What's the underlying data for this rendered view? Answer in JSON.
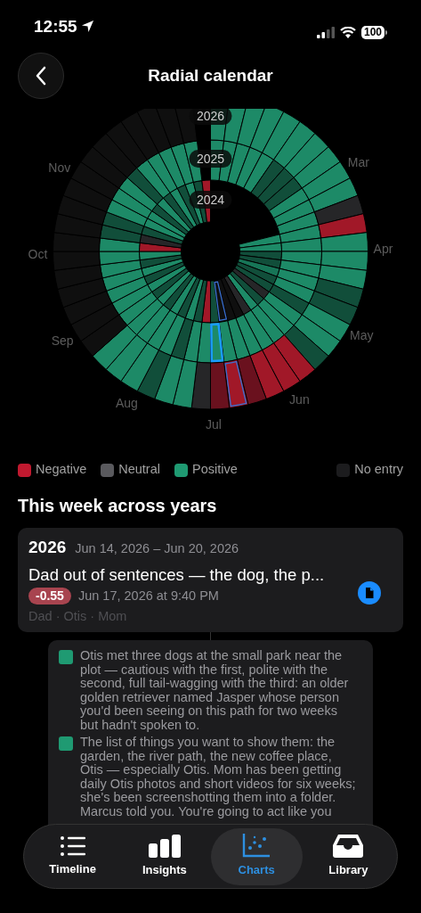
{
  "status_bar": {
    "time": "12:55",
    "battery": "100"
  },
  "header": {
    "title": "Radial calendar"
  },
  "radial_calendar": {
    "years": [
      "2026",
      "2025",
      "2024"
    ],
    "months": [
      "Mar",
      "Apr",
      "May",
      "Jun",
      "Jul",
      "Aug",
      "Sep",
      "Oct",
      "Nov"
    ]
  },
  "legend": [
    {
      "label": "Negative",
      "color": "#c0192f"
    },
    {
      "label": "Neutral",
      "color": "#5a5a5e"
    },
    {
      "label": "Positive",
      "color": "#1f9a72"
    },
    {
      "label": "No entry",
      "color": "#1c1c1e"
    }
  ],
  "section_title": "This week across years",
  "week_card": {
    "year": "2026",
    "range": "Jun 14, 2026 – Jun 20, 2026",
    "title": "Dad out of sentences — the dog, the p...",
    "score": "-0.55",
    "date": "Jun 17, 2026 at 9:40 PM",
    "people": "Dad · Otis · Mom"
  },
  "details": [
    {
      "text": "Otis met three dogs at the small park near the plot — cautious with the first, polite with the second, full tail-wagging with the third: an older golden retriever named Jasper whose person you'd been seeing on this path for two weeks but hadn't spoken to.",
      "color": "#1f9a72"
    },
    {
      "text": "The list of things you want to show them: the garden, the river path, the new coffee place, Otis — especially Otis. Mom has been getting daily Otis photos and short videos for six weeks; she's been screenshotting them into a folder. Marcus told you. You're going to act like you",
      "color": "#1f9a72"
    }
  ],
  "tabs": [
    {
      "label": "Timeline",
      "selected": false
    },
    {
      "label": "Insights",
      "selected": false
    },
    {
      "label": "Charts",
      "selected": true
    },
    {
      "label": "Library",
      "selected": false
    }
  ]
}
